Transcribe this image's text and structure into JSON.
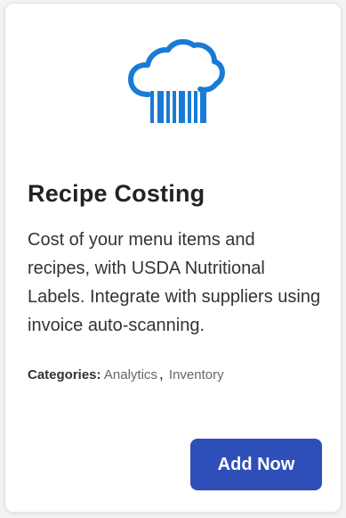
{
  "card": {
    "logo_icon": "cloud-barcode-icon",
    "logo_color": "#1a7bd6",
    "title": "Recipe Costing",
    "description": "Cost of your menu items and recipes, with USDA Nutritional Labels. Integrate with suppliers using invoice auto-scanning.",
    "categories_label": "Categories:",
    "categories": [
      "Analytics",
      "Inventory"
    ],
    "categories_separator": ",",
    "button_label": "Add Now",
    "button_color": "#2e4fb8"
  }
}
